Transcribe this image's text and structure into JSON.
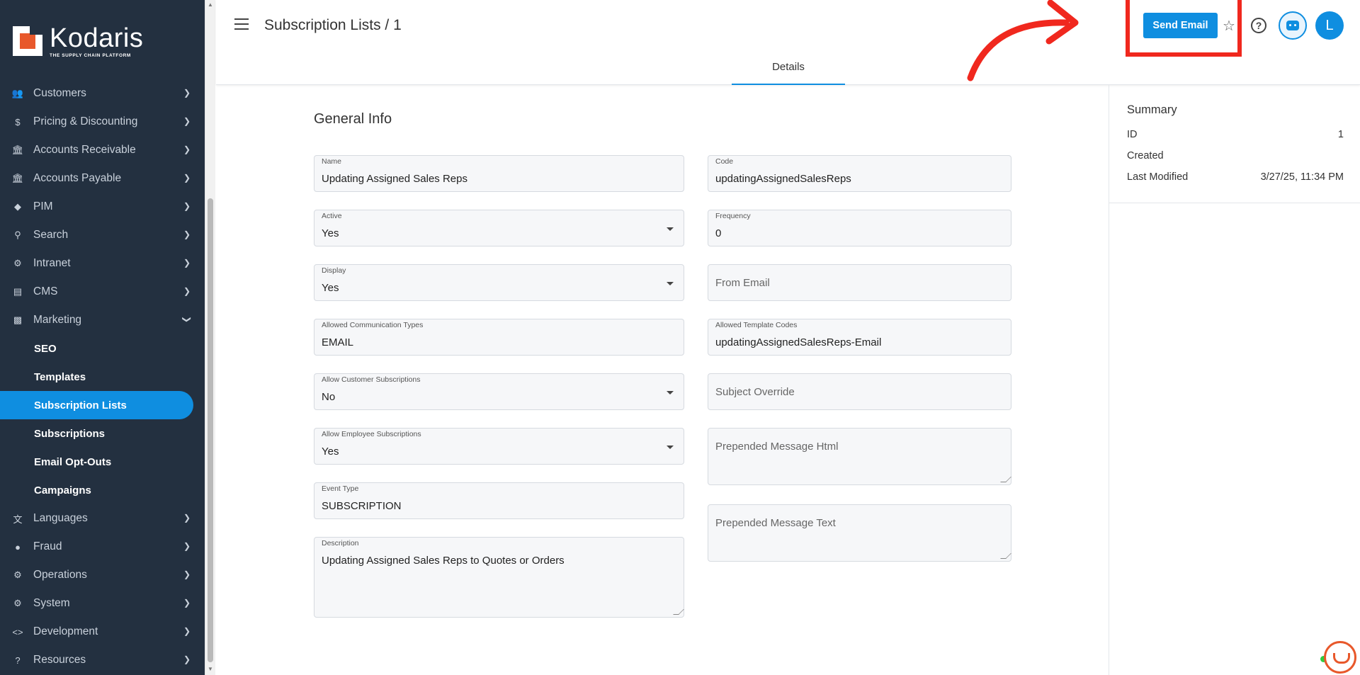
{
  "brand": {
    "name": "Kodaris",
    "tagline": "THE SUPPLY CHAIN PLATFORM",
    "accent": "#0f8ee0",
    "logo_color": "#e8582b",
    "highlight_color": "#f0281e"
  },
  "sidebar": {
    "items": [
      {
        "label": "Customers",
        "icon": "users-icon"
      },
      {
        "label": "Pricing & Discounting",
        "icon": "dollar-icon"
      },
      {
        "label": "Accounts Receivable",
        "icon": "bank-icon"
      },
      {
        "label": "Accounts Payable",
        "icon": "bank-icon"
      },
      {
        "label": "PIM",
        "icon": "tag-icon"
      },
      {
        "label": "Search",
        "icon": "search-icon"
      },
      {
        "label": "Intranet",
        "icon": "globe-icon"
      },
      {
        "label": "CMS",
        "icon": "cms-icon"
      },
      {
        "label": "Marketing",
        "icon": "marketing-icon"
      }
    ],
    "marketing_sub": [
      "SEO",
      "Templates",
      "Subscription Lists",
      "Subscriptions",
      "Email Opt-Outs",
      "Campaigns"
    ],
    "items_after": [
      {
        "label": "Languages",
        "icon": "translate-icon"
      },
      {
        "label": "Fraud",
        "icon": "alert-icon"
      },
      {
        "label": "Operations",
        "icon": "operations-icon"
      },
      {
        "label": "System",
        "icon": "gear-icon"
      },
      {
        "label": "Development",
        "icon": "code-icon"
      },
      {
        "label": "Resources",
        "icon": "help-icon"
      }
    ]
  },
  "header": {
    "title": "Subscription Lists / 1",
    "send_email": "Send Email",
    "avatar_initial": "L",
    "tab": "Details"
  },
  "form": {
    "section_title": "General Info",
    "left": [
      {
        "label": "Name",
        "value": "Updating Assigned Sales Reps"
      },
      {
        "label": "Active",
        "value": "Yes"
      },
      {
        "label": "Display",
        "value": "Yes"
      },
      {
        "label": "Allowed Communication Types",
        "value": "EMAIL"
      },
      {
        "label": "Allow Customer Subscriptions",
        "value": "No"
      },
      {
        "label": "Allow Employee Subscriptions",
        "value": "Yes"
      },
      {
        "label": "Event Type",
        "value": "SUBSCRIPTION"
      },
      {
        "label": "Description",
        "value": "Updating Assigned Sales Reps to Quotes or Orders"
      }
    ],
    "right": [
      {
        "label": "Code",
        "value": "updatingAssignedSalesReps"
      },
      {
        "label": "Frequency",
        "value": "0"
      },
      {
        "placeholder": "From Email"
      },
      {
        "label": "Allowed Template Codes",
        "value": "updatingAssignedSalesReps-Email"
      },
      {
        "placeholder": "Subject Override"
      },
      {
        "placeholder": "Prepended Message Html"
      },
      {
        "placeholder": "Prepended Message Text"
      }
    ]
  },
  "summary": {
    "title": "Summary",
    "rows": [
      {
        "label": "ID",
        "value": "1"
      },
      {
        "label": "Created",
        "value": ""
      },
      {
        "label": "Last Modified",
        "value": "3/27/25, 11:34 PM"
      }
    ]
  }
}
